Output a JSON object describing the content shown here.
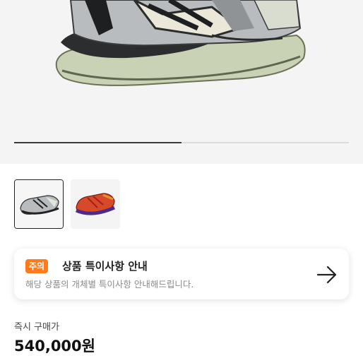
{
  "gallery": {
    "progress": 0.5,
    "thumbnails": [
      {
        "name": "thumbnail-grey-sneaker",
        "selected": true
      },
      {
        "name": "thumbnail-red-sneaker",
        "selected": false
      }
    ]
  },
  "notice": {
    "badge": "주의",
    "title": "상품 특이사항 안내",
    "description": "해당 상품의 개체별 특이사항 안내해드립니다.",
    "icon": "arrow-right-icon"
  },
  "price": {
    "label": "즉시 구매가",
    "value": "540,000원"
  },
  "colors": {
    "accent": "#ff7a1a",
    "hero_background": "#f4f4f4"
  }
}
